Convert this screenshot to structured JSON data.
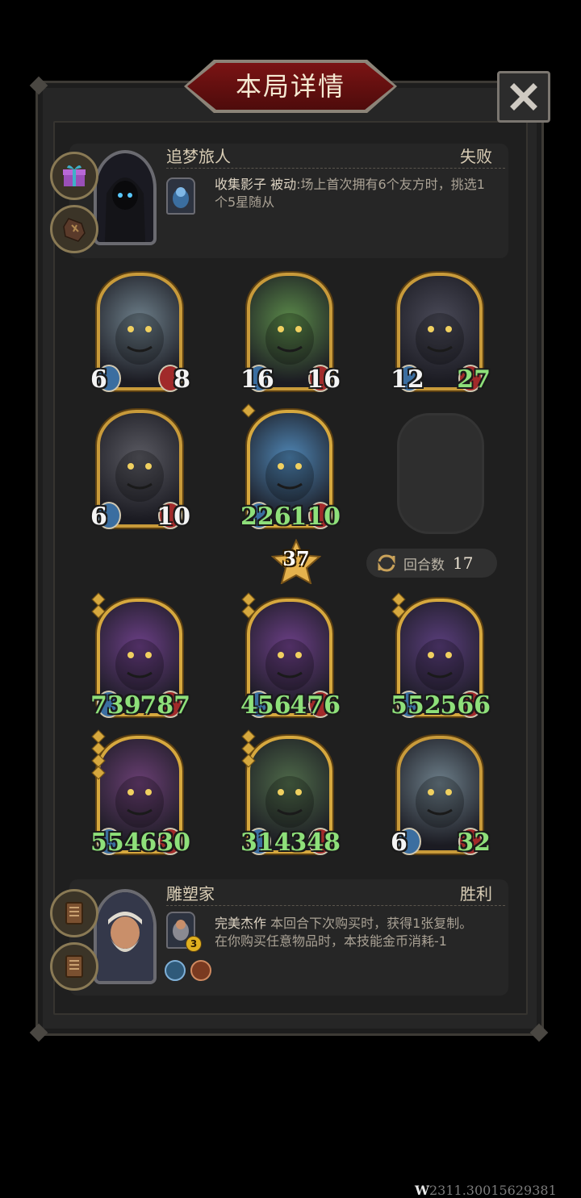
{
  "title": "本局详情",
  "top_player": {
    "name": "追梦旅人",
    "result": "失败",
    "skill_name": "收集影子",
    "skill_type": "被动",
    "skill_desc": ":场上首次拥有6个友方时，挑选1个5星随从"
  },
  "opponent_board": [
    {
      "atk": "6",
      "hp": "8",
      "atk_color": "white",
      "hp_color": "white",
      "stars": 0
    },
    {
      "atk": "16",
      "hp": "16",
      "atk_color": "white",
      "hp_color": "white",
      "stars": 0
    },
    {
      "atk": "12",
      "hp": "27",
      "atk_color": "white",
      "hp_color": "green",
      "stars": 0
    },
    {
      "atk": "6",
      "hp": "10",
      "atk_color": "white",
      "hp_color": "white",
      "stars": 0
    },
    {
      "atk": "226",
      "hp": "110",
      "atk_color": "green",
      "hp_color": "green",
      "stars": 1
    }
  ],
  "tier": "37",
  "turn": {
    "label": "回合数",
    "value": "17"
  },
  "player_board": [
    {
      "atk": "739",
      "hp": "787",
      "atk_color": "green",
      "hp_color": "green",
      "stars": 2
    },
    {
      "atk": "456",
      "hp": "476",
      "atk_color": "green",
      "hp_color": "green",
      "stars": 2
    },
    {
      "atk": "552",
      "hp": "566",
      "atk_color": "green",
      "hp_color": "green",
      "stars": 2
    },
    {
      "atk": "554",
      "hp": "630",
      "atk_color": "green",
      "hp_color": "green",
      "stars": 4
    },
    {
      "atk": "314",
      "hp": "348",
      "atk_color": "green",
      "hp_color": "green",
      "stars": 3
    },
    {
      "atk": "6",
      "hp": "32",
      "atk_color": "white",
      "hp_color": "green",
      "stars": 0
    }
  ],
  "bottom_player": {
    "name": "雕塑家",
    "result": "胜利",
    "skill_name": "完美杰作",
    "skill_desc_line1": "本回合下次购买时，获得1张复制。",
    "skill_desc_line2": "在你购买任意物品时，本技能金币消耗-1",
    "skill_cost": "3"
  },
  "watermark": {
    "prefix": "W",
    "code": "2311.30015629381"
  },
  "colors": {
    "gold_frame": "#c89a3a",
    "stat_green": "#8ee07a",
    "banner_red": "#7a1414"
  }
}
